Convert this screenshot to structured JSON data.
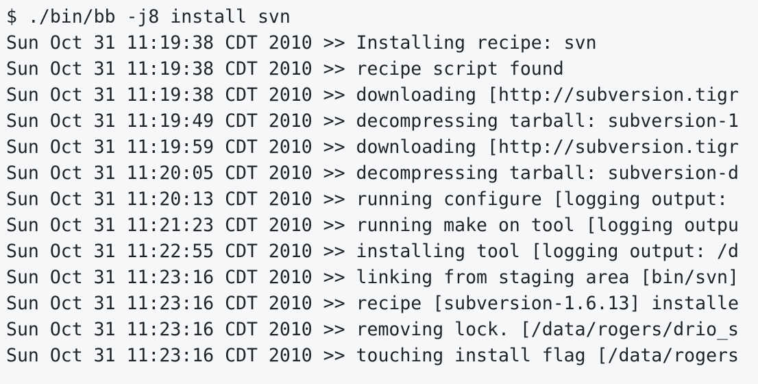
{
  "terminal": {
    "command": "$ ./bin/bb -j8 install svn",
    "lines": [
      "Sun Oct 31 11:19:38 CDT 2010 >> Installing recipe: svn",
      "Sun Oct 31 11:19:38 CDT 2010 >> recipe script found",
      "Sun Oct 31 11:19:38 CDT 2010 >> downloading [http://subversion.tigr",
      "Sun Oct 31 11:19:49 CDT 2010 >> decompressing tarball: subversion-1",
      "Sun Oct 31 11:19:59 CDT 2010 >> downloading [http://subversion.tigr",
      "Sun Oct 31 11:20:05 CDT 2010 >> decompressing tarball: subversion-d",
      "Sun Oct 31 11:20:13 CDT 2010 >> running configure [logging output:",
      "Sun Oct 31 11:21:23 CDT 2010 >> running make on tool [logging outpu",
      "Sun Oct 31 11:22:55 CDT 2010 >> installing tool [logging output: /d",
      "Sun Oct 31 11:23:16 CDT 2010 >> linking from staging area [bin/svn]",
      "Sun Oct 31 11:23:16 CDT 2010 >> recipe [subversion-1.6.13] installe",
      "Sun Oct 31 11:23:16 CDT 2010 >> removing lock. [/data/rogers/drio_s",
      "Sun Oct 31 11:23:16 CDT 2010 >> touching install flag [/data/rogers"
    ]
  }
}
